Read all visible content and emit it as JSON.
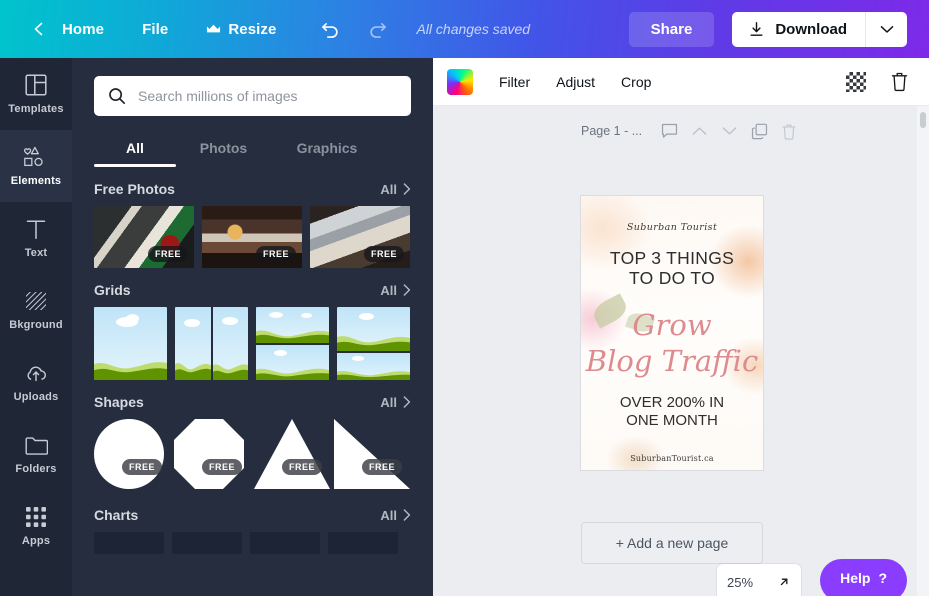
{
  "topbar": {
    "back_icon": "chevron-left-icon",
    "home": "Home",
    "file": "File",
    "resize": "Resize",
    "resize_icon": "crown-icon",
    "undo_icon": "undo-icon",
    "redo_icon": "redo-icon",
    "status": "All changes saved",
    "share": "Share",
    "download": "Download",
    "download_icon": "download-icon",
    "download_caret_icon": "chevron-down-icon",
    "gradient_start": "#00c4cc",
    "gradient_end": "#7d2ae8"
  },
  "rail": {
    "items": [
      {
        "label": "Templates",
        "icon": "templates-icon",
        "active": false
      },
      {
        "label": "Elements",
        "icon": "elements-icon",
        "active": true
      },
      {
        "label": "Text",
        "icon": "text-icon",
        "active": false
      },
      {
        "label": "Bkground",
        "icon": "background-icon",
        "active": false
      },
      {
        "label": "Uploads",
        "icon": "upload-cloud-icon",
        "active": false
      },
      {
        "label": "Folders",
        "icon": "folder-icon",
        "active": false
      },
      {
        "label": "Apps",
        "icon": "apps-grid-icon",
        "active": false
      }
    ]
  },
  "panel": {
    "search": {
      "placeholder": "Search millions of images",
      "value": "",
      "icon": "search-icon"
    },
    "tabs": [
      {
        "label": "All",
        "active": true
      },
      {
        "label": "Photos",
        "active": false
      },
      {
        "label": "Graphics",
        "active": false
      }
    ],
    "all_label": "All",
    "sections": [
      {
        "title": "Free Photos",
        "all": "All",
        "badges": [
          "FREE",
          "FREE",
          "FREE"
        ]
      },
      {
        "title": "Grids",
        "all": "All",
        "badges": []
      },
      {
        "title": "Shapes",
        "all": "All",
        "badges": [
          "FREE",
          "FREE",
          "FREE",
          "FREE"
        ]
      },
      {
        "title": "Charts",
        "all": "All",
        "badges": []
      }
    ],
    "collapse_icon": "chevron-left-icon"
  },
  "imagebar": {
    "swatch": "color-swatch",
    "filter": "Filter",
    "adjust": "Adjust",
    "crop": "Crop",
    "transparency_icon": "checkerboard-icon",
    "delete_icon": "trash-icon"
  },
  "pagebar": {
    "label": "Page 1 - ...",
    "notes_icon": "comment-icon",
    "up_icon": "chevron-up-icon",
    "down_icon": "chevron-down-icon",
    "duplicate_icon": "copy-icon",
    "delete_icon": "trash-icon"
  },
  "design": {
    "brand": "Suburban Tourist",
    "headline": "TOP 3 THINGS\nTO DO TO",
    "script_line1": "Grow",
    "script_line2": "Blog Traffic",
    "subhead": "OVER 200% IN\nONE MONTH",
    "url": "SuburbanTourist.ca",
    "script_color": "#dd8b8f"
  },
  "footer": {
    "add_page": "+ Add a new page",
    "zoom": "25%",
    "expand_icon": "expand-arrow-icon",
    "help": "Help",
    "help_icon": "question-mark-icon",
    "help_color": "#8b3dff"
  }
}
